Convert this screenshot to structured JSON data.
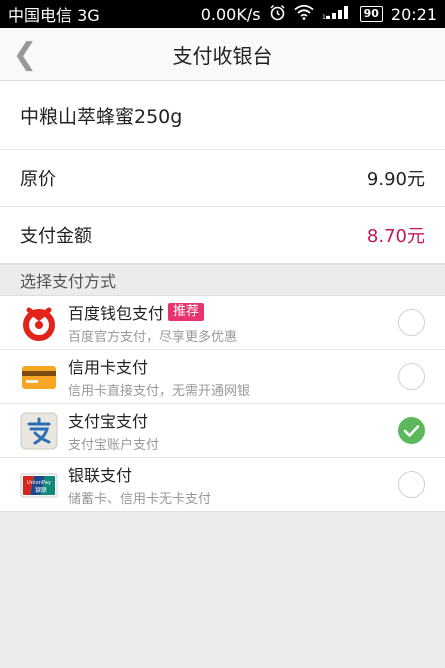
{
  "status_bar": {
    "carrier": "中国电信 3G",
    "network_speed": "0.00K/s",
    "battery": "90",
    "time": "20:21"
  },
  "nav": {
    "back_glyph": "❮",
    "title": "支付收银台"
  },
  "order": {
    "product_name": "中粮山萃蜂蜜250g",
    "original_price_label": "原价",
    "original_price": "9.90元",
    "pay_amount_label": "支付金额",
    "pay_amount": "8.70元"
  },
  "payment": {
    "section_label": "选择支付方式",
    "methods": [
      {
        "name": "百度钱包支付",
        "tag": "推荐",
        "desc": "百度官方支付，尽享更多优惠",
        "icon": "baidu-wallet-icon",
        "selected": false
      },
      {
        "name": "信用卡支付",
        "desc": "信用卡直接支付，无需开通网银",
        "icon": "credit-card-icon",
        "selected": false
      },
      {
        "name": "支付宝支付",
        "desc": "支付宝账户支付",
        "icon": "alipay-icon",
        "selected": true
      },
      {
        "name": "银联支付",
        "desc": "储蓄卡、信用卡无卡支付",
        "icon": "unionpay-icon",
        "icon_text_top": "UnionPay",
        "icon_text_bottom": "银联",
        "selected": false
      }
    ]
  },
  "colors": {
    "pay_amount": "#c2185b",
    "tag_bg": "#e8336e",
    "check_green": "#5cb85c",
    "baidu_red": "#e2231a",
    "card_yellow": "#f6a623"
  }
}
